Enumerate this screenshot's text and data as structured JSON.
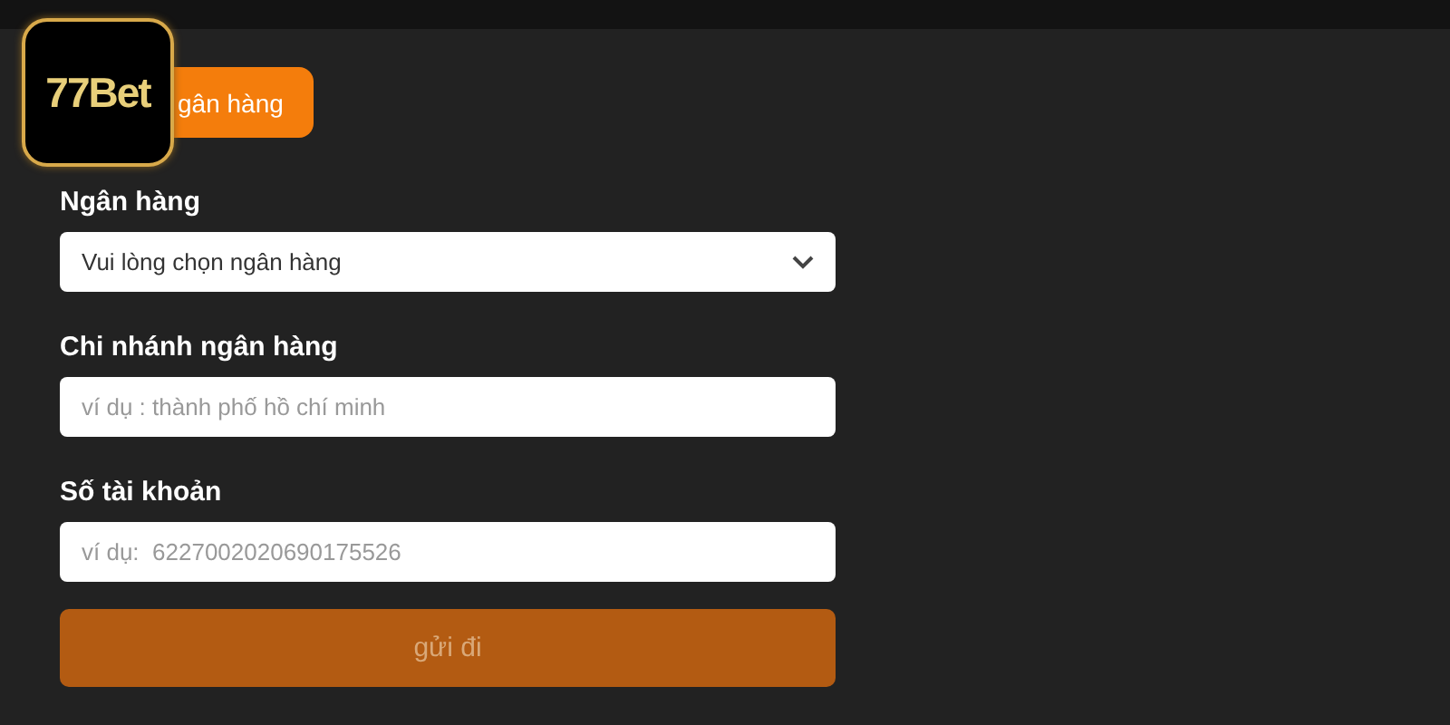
{
  "logo": {
    "text": "77Bet"
  },
  "tabs": [
    {
      "label": "gân hàng",
      "selected": true
    }
  ],
  "form": {
    "fields": [
      {
        "label": "Ngân hàng",
        "kind": "select",
        "placeholder": "Vui lòng chọn ngân hàng"
      },
      {
        "label": "Chi nhánh ngân hàng",
        "kind": "text",
        "placeholder": "ví dụ : thành phố hồ chí minh"
      },
      {
        "label": "Số tài khoản",
        "kind": "text",
        "placeholder": "ví dụ:  6227002020690175526"
      }
    ],
    "submit": {
      "label": "gửi đi",
      "disabled": true
    }
  }
}
